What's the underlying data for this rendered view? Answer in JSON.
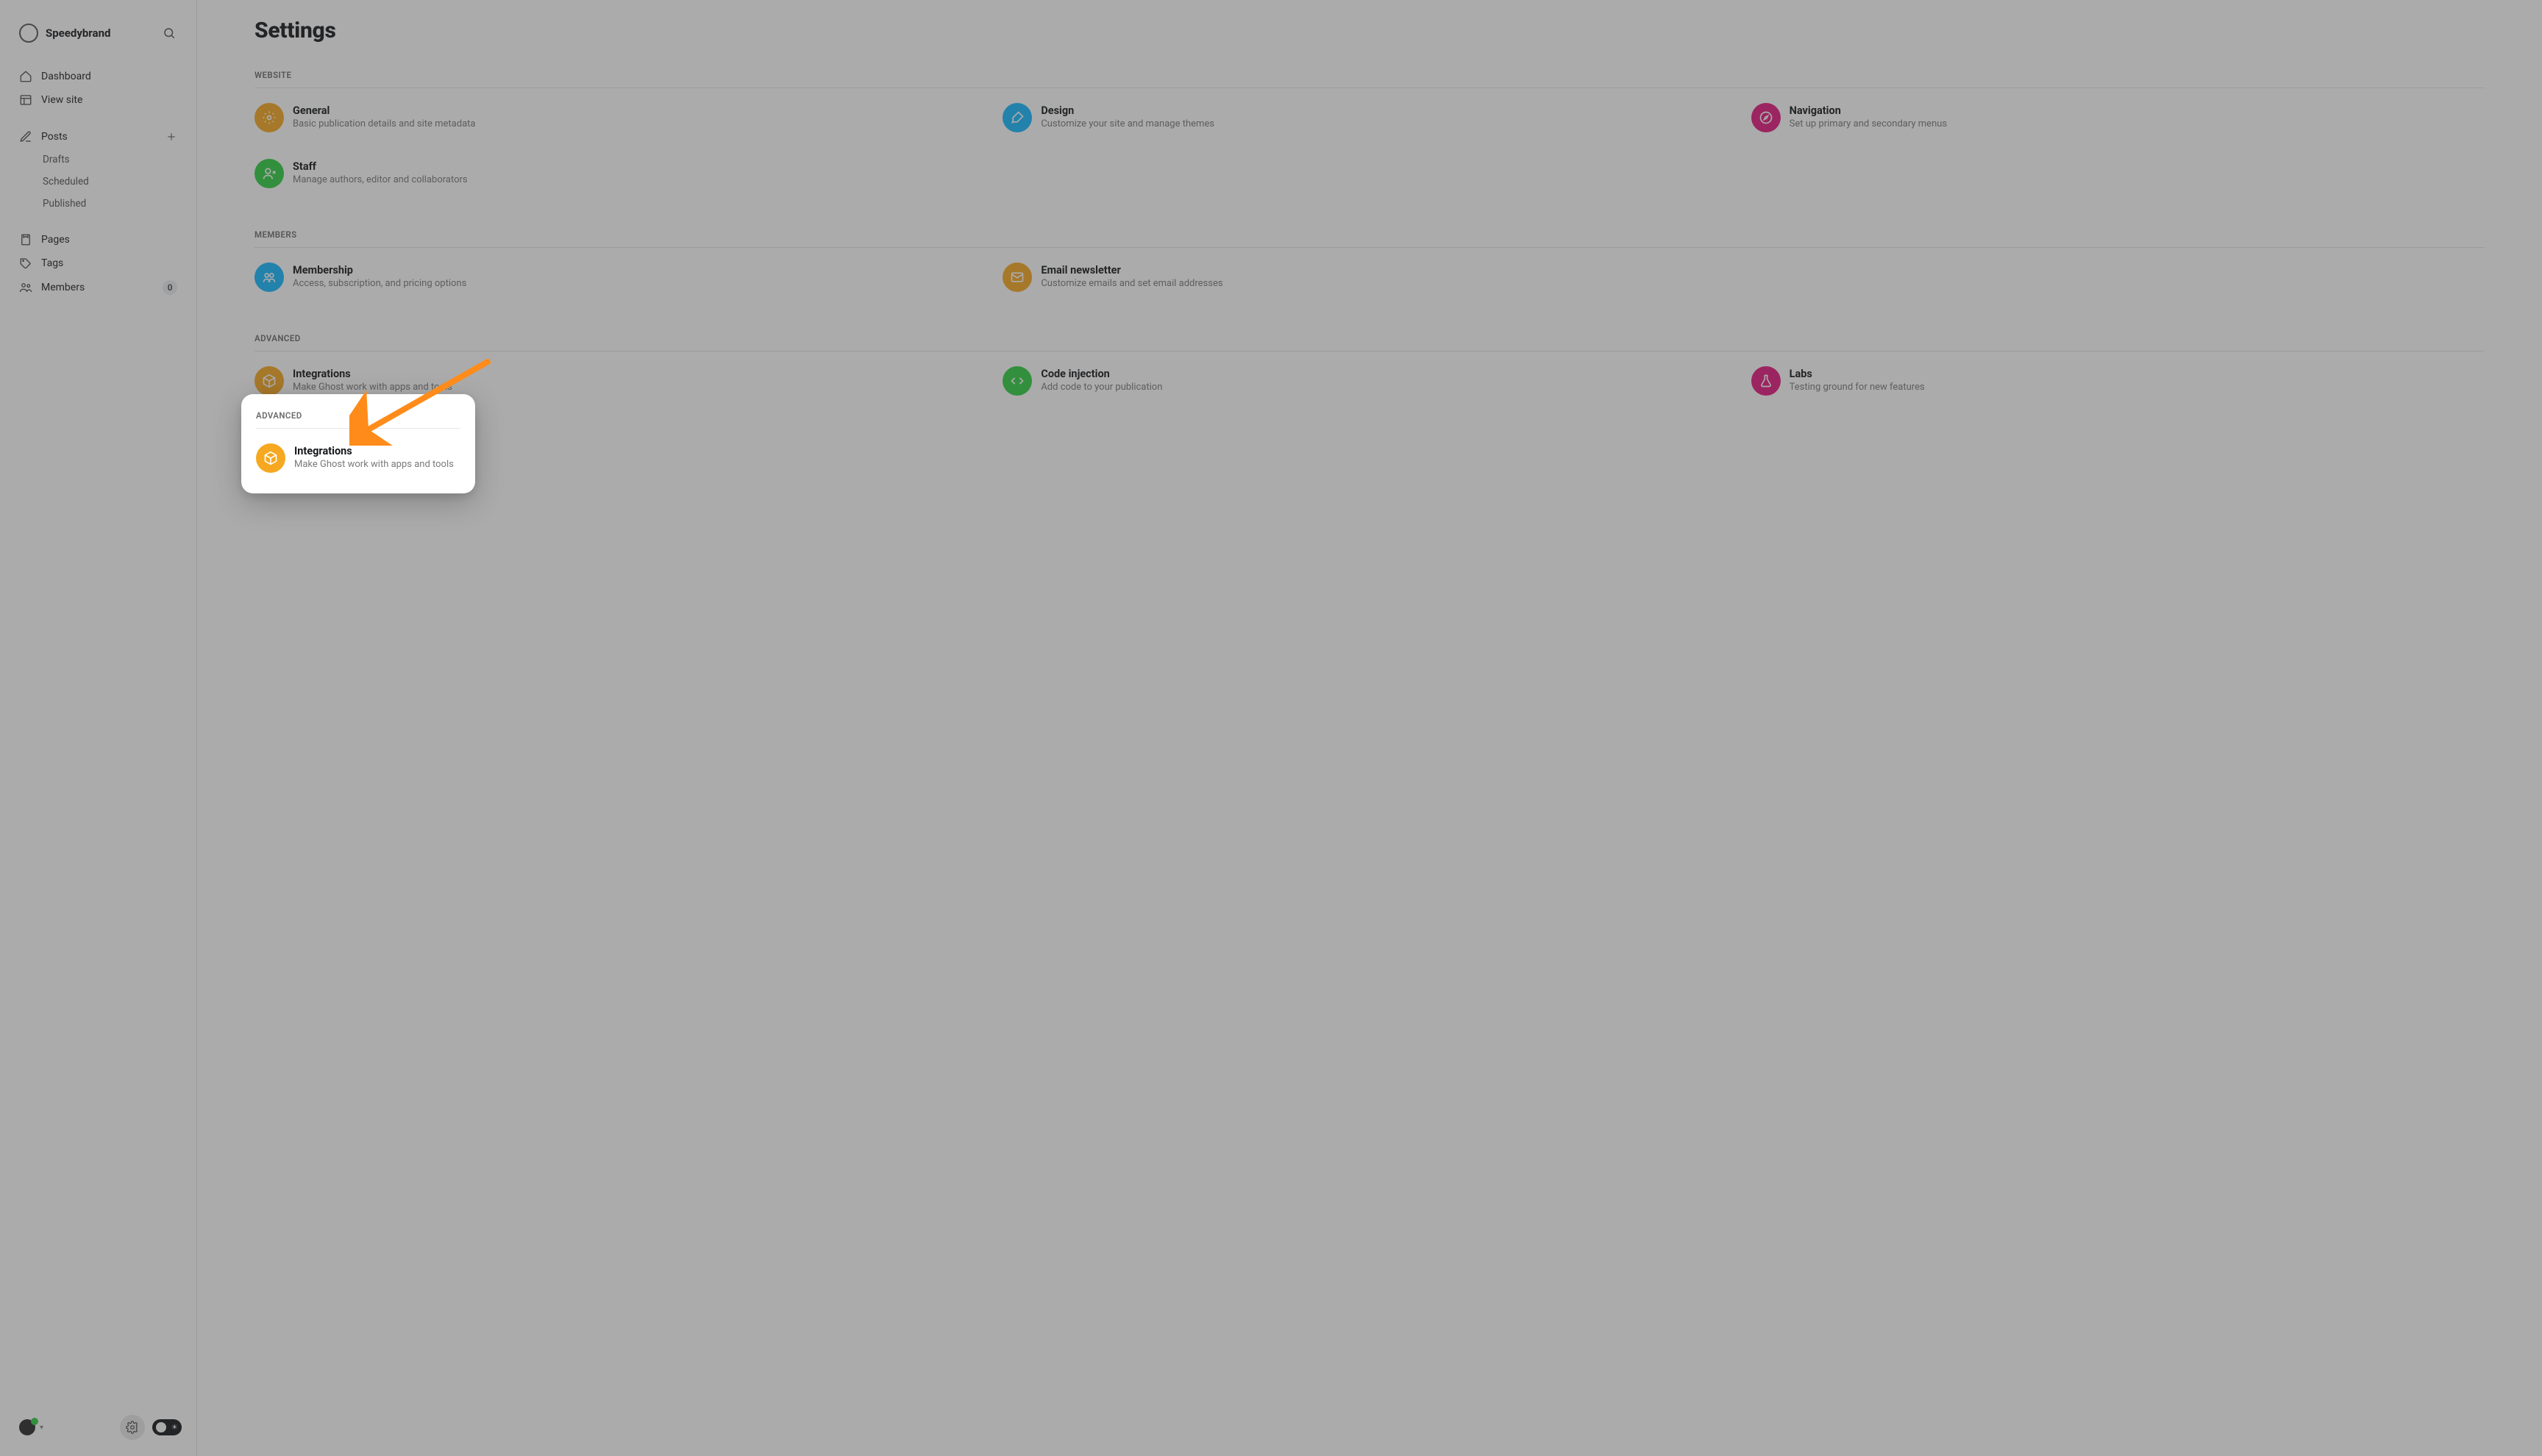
{
  "sidebar": {
    "brand": "Speedybrand",
    "nav1": [
      {
        "label": "Dashboard",
        "icon": "home-icon"
      },
      {
        "label": "View site",
        "icon": "layout-icon"
      }
    ],
    "posts": {
      "label": "Posts",
      "icon": "edit-icon"
    },
    "posts_sub": [
      {
        "label": "Drafts"
      },
      {
        "label": "Scheduled"
      },
      {
        "label": "Published"
      }
    ],
    "nav3": [
      {
        "label": "Pages",
        "icon": "page-icon"
      },
      {
        "label": "Tags",
        "icon": "tag-icon"
      },
      {
        "label": "Members",
        "icon": "members-icon",
        "count": "0"
      }
    ]
  },
  "page": {
    "title": "Settings"
  },
  "colors": {
    "orange": "#f6a821",
    "blue": "#14b8ff",
    "pink": "#e3197e",
    "green": "#30cf43",
    "arrow": "#ff8c1a"
  },
  "sections": {
    "website": {
      "label": "WEBSITE",
      "cards": {
        "general": {
          "title": "General",
          "desc": "Basic publication details and site metadata"
        },
        "design": {
          "title": "Design",
          "desc": "Customize your site and manage themes"
        },
        "navigation": {
          "title": "Navigation",
          "desc": "Set up primary and secondary menus"
        },
        "staff": {
          "title": "Staff",
          "desc": "Manage authors, editor and collaborators"
        }
      }
    },
    "members": {
      "label": "MEMBERS",
      "cards": {
        "membership": {
          "title": "Membership",
          "desc": "Access, subscription, and pricing options"
        },
        "email": {
          "title": "Email newsletter",
          "desc": "Customize emails and set email addresses"
        }
      }
    },
    "advanced": {
      "label": "ADVANCED",
      "cards": {
        "integrations": {
          "title": "Integrations",
          "desc": "Make Ghost work with apps and tools"
        },
        "code": {
          "title": "Code injection",
          "desc": "Add code to your publication"
        },
        "labs": {
          "title": "Labs",
          "desc": "Testing ground for new features"
        }
      }
    }
  }
}
